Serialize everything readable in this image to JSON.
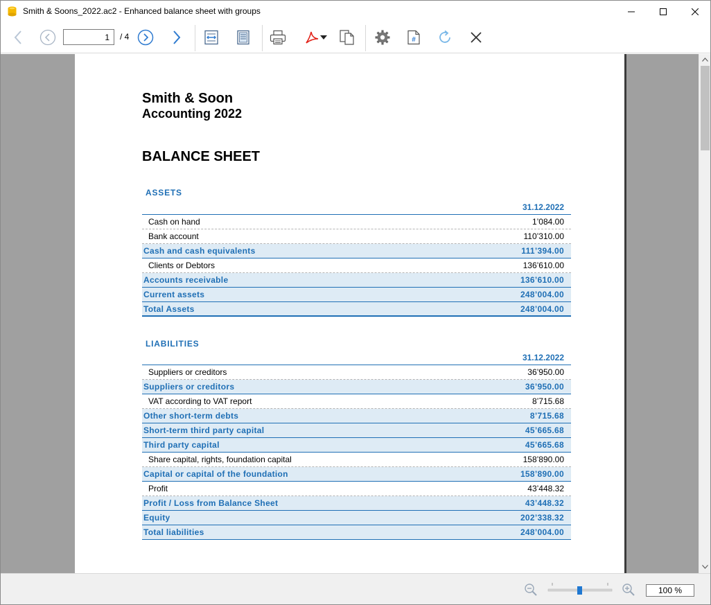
{
  "window": {
    "title": "Smith & Soons_2022.ac2 - Enhanced balance sheet with groups",
    "min_label": "minimize",
    "max_label": "maximize",
    "close_label": "close"
  },
  "toolbar": {
    "page_value": "1",
    "page_total": "/ 4",
    "icons": [
      "back-arrow-icon",
      "previous-page-icon",
      "next-page-icon",
      "forward-arrow-icon",
      "fit-width-icon",
      "fit-page-icon",
      "print-icon",
      "pdf-icon",
      "copy-icon",
      "settings-icon",
      "page-number-icon",
      "refresh-icon",
      "close-icon"
    ]
  },
  "document": {
    "company": "Smith & Soon",
    "accounting_year": "Accounting 2022",
    "heading": "BALANCE SHEET",
    "assets": {
      "title": "ASSETS",
      "date": "31.12.2022",
      "rows": [
        {
          "label": "Cash on hand",
          "amount": "1’084.00",
          "kind": "acc"
        },
        {
          "label": "Bank account",
          "amount": "110’310.00",
          "kind": "acc"
        },
        {
          "label": "Cash and cash equivalents",
          "amount": "111’394.00",
          "kind": "grp"
        },
        {
          "label": "Clients or Debtors",
          "amount": "136’610.00",
          "kind": "acc"
        },
        {
          "label": "Accounts receivable",
          "amount": "136’610.00",
          "kind": "grp"
        },
        {
          "label": "Current assets",
          "amount": "248’004.00",
          "kind": "grp"
        },
        {
          "label": "Total Assets",
          "amount": "248’004.00",
          "kind": "total"
        }
      ]
    },
    "liabilities": {
      "title": "LIABILITIES",
      "date": "31.12.2022",
      "rows": [
        {
          "label": "Suppliers or creditors",
          "amount": "36’950.00",
          "kind": "acc"
        },
        {
          "label": "Suppliers or creditors",
          "amount": "36’950.00",
          "kind": "grp"
        },
        {
          "label": "VAT according to VAT report",
          "amount": "8’715.68",
          "kind": "acc"
        },
        {
          "label": "Other short-term debts",
          "amount": "8’715.68",
          "kind": "grp"
        },
        {
          "label": "Short-term third party capital",
          "amount": "45’665.68",
          "kind": "grp"
        },
        {
          "label": "Third party capital",
          "amount": "45’665.68",
          "kind": "grp"
        },
        {
          "label": "Share capital, rights, foundation capital",
          "amount": "158’890.00",
          "kind": "acc"
        },
        {
          "label": "Capital or capital of the foundation",
          "amount": "158’890.00",
          "kind": "grp"
        },
        {
          "label": "Profit",
          "amount": "43’448.32",
          "kind": "acc"
        },
        {
          "label": "Profit / Loss from Balance Sheet",
          "amount": "43’448.32",
          "kind": "grp"
        },
        {
          "label": "Equity",
          "amount": "202’338.32",
          "kind": "grp"
        },
        {
          "label": "Total liabilities",
          "amount": "248’004.00",
          "kind": "grp"
        }
      ]
    }
  },
  "statusbar": {
    "zoom_value": "100 %",
    "zoom_level_percent": 100
  },
  "colors": {
    "accent_blue": "#1f6fb5",
    "group_row_bg": "#deebf5",
    "viewer_bg": "#a0a0a0"
  }
}
